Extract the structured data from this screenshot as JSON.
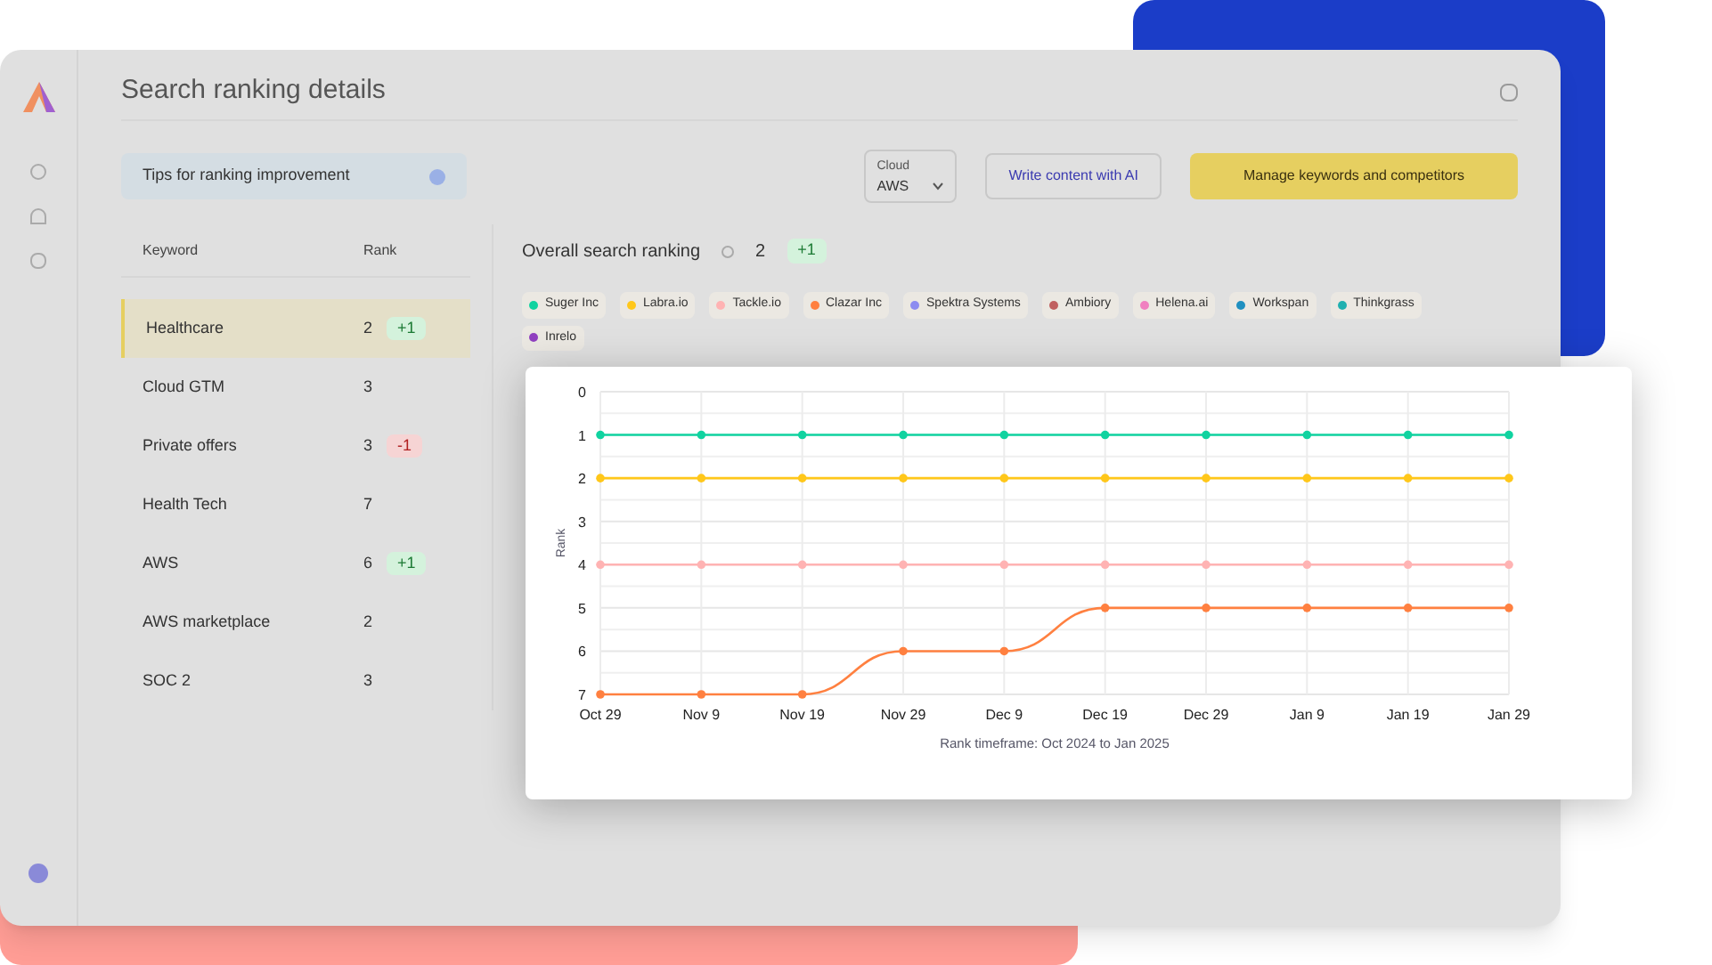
{
  "app": {
    "title": "Search ranking details",
    "tips": {
      "label": "Tips for ranking improvement"
    },
    "cloud": {
      "label": "Cloud",
      "value": "AWS"
    },
    "write_button": "Write content with AI",
    "manage_button": "Manage keywords and competitors",
    "table": {
      "columns": [
        "Keyword",
        "Rank"
      ],
      "rows": [
        {
          "keyword": "Healthcare",
          "rank": "2",
          "badge": "+1",
          "kind": "up",
          "selected": true
        },
        {
          "keyword": "Cloud GTM",
          "rank": "3",
          "selected": false
        },
        {
          "keyword": "Private offers",
          "rank": "3",
          "badge": "-1",
          "kind": "down",
          "selected": false
        },
        {
          "keyword": "Health Tech",
          "rank": "7",
          "selected": false
        },
        {
          "keyword": "AWS",
          "rank": "6",
          "badge": "+1",
          "kind": "up",
          "selected": false
        },
        {
          "keyword": "AWS marketplace",
          "rank": "2",
          "selected": false
        },
        {
          "keyword": "SOC 2",
          "rank": "3",
          "selected": false
        }
      ]
    },
    "overall": {
      "label": "Overall search ranking",
      "value": "2",
      "badge": "+1"
    },
    "legend": [
      {
        "name": "Suger Inc",
        "color": "#10d3a0"
      },
      {
        "name": "Labra.io",
        "color": "#ffc71a"
      },
      {
        "name": "Tackle.io",
        "color": "#ffb3b3"
      },
      {
        "name": "Clazar Inc",
        "color": "#ff8040"
      },
      {
        "name": "Spektra Systems",
        "color": "#8c8cf0"
      },
      {
        "name": "Ambiory",
        "color": "#c06060"
      },
      {
        "name": "Helena.ai",
        "color": "#f080c0"
      },
      {
        "name": "Workspan",
        "color": "#2090c0"
      },
      {
        "name": "Thinkgrass",
        "color": "#20b0b0"
      },
      {
        "name": "Inrelo",
        "color": "#9040c0"
      }
    ]
  },
  "chart": {
    "chart_data": {
      "type": "line",
      "ylabel": "Rank",
      "xlabel": "Rank timeframe: Oct 2024 to Jan 2025",
      "categories": [
        "Oct 29",
        "Nov 9",
        "Nov 19",
        "Nov 29",
        "Dec 9",
        "Dec 19",
        "Dec 29",
        "Jan 9",
        "Jan 19",
        "Jan 29"
      ],
      "ylim": [
        7,
        0
      ],
      "yticks": [
        0,
        1,
        2,
        3,
        4,
        5,
        6,
        7
      ],
      "grid": true,
      "series": [
        {
          "color": "#10d3a0",
          "marker": "circle",
          "values": [
            1,
            1,
            1,
            1,
            1,
            1,
            1,
            1,
            1,
            1
          ]
        },
        {
          "color": "#ffc71a",
          "marker": "circle",
          "values": [
            2,
            2,
            2,
            2,
            2,
            2,
            2,
            2,
            2,
            2
          ]
        },
        {
          "color": "#ffb3b3",
          "marker": "circle",
          "values": [
            4,
            4,
            4,
            4,
            4,
            4,
            4,
            4,
            4,
            4
          ]
        },
        {
          "color": "#ff8040",
          "marker": "circle",
          "values": [
            7,
            7,
            7,
            6,
            6,
            5,
            5,
            5,
            5,
            5
          ]
        }
      ]
    }
  }
}
